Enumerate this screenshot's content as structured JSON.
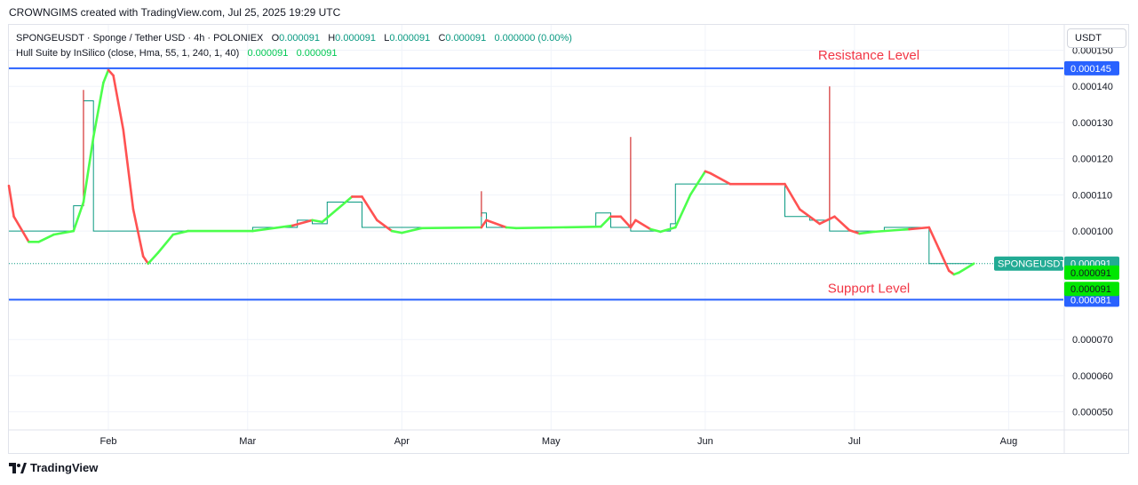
{
  "header": {
    "credit": "CROWNGIMS created with TradingView.com, Jul 25, 2025 19:29 UTC"
  },
  "legend": {
    "symbol_line": "SPONGEUSDT · Sponge / Tether USD · 4h · POLONIEX",
    "o_label": "O",
    "o_value": "0.000091",
    "h_label": "H",
    "h_value": "0.000091",
    "l_label": "L",
    "l_value": "0.000091",
    "c_label": "C",
    "c_value": "0.000091",
    "change": "0.000000 (0.00%)",
    "indicator_line": "Hull Suite by InSilico (close, Hma, 55, 1, 240, 1, 40)",
    "indicator_v1": "0.000091",
    "indicator_v2": "0.000091"
  },
  "currency_button": "USDT",
  "footer": {
    "brand": "TradingView"
  },
  "colors": {
    "price_line": "#089981",
    "hull_up": "#4cff4c",
    "hull_down": "#ff5252",
    "level_line": "#2962ff",
    "annotation": "#f23645",
    "symbol_tag": "#22ab94"
  },
  "chart_data": {
    "type": "line",
    "title": "",
    "ylim": [
      4.5e-05,
      0.000157
    ],
    "yaxis_ticks": [
      "0.000150",
      "0.000140",
      "0.000130",
      "0.000120",
      "0.000110",
      "0.000100",
      "0.000070",
      "0.000060",
      "0.000050"
    ],
    "xaxis_ticks": [
      "Feb",
      "Mar",
      "Apr",
      "May",
      "Jun",
      "Jul",
      "Aug"
    ],
    "grid": true,
    "horizontal_levels": [
      {
        "label": "Resistance Level",
        "value": 0.000145,
        "tag": "0.000145"
      },
      {
        "label": "Support Level",
        "value": 8.1e-05,
        "tag": "0.000081"
      }
    ],
    "price_tags": [
      {
        "text": "SPONGEUSDT",
        "value": 9.1e-05
      },
      {
        "text": "0.000091",
        "value": 9.1e-05
      },
      {
        "text": "0.000091",
        "value": 8.85e-05
      },
      {
        "text": "0.000091",
        "value": 8.4e-05
      }
    ],
    "price_series": [
      {
        "x": "2025-01-12",
        "y": 0.0001
      },
      {
        "x": "2025-01-25",
        "y": 0.0001
      },
      {
        "x": "2025-01-25",
        "y": 0.000107
      },
      {
        "x": "2025-01-27",
        "y": 0.000107
      },
      {
        "x": "2025-01-27",
        "y": 0.000136
      },
      {
        "x": "2025-01-29",
        "y": 0.000136
      },
      {
        "x": "2025-01-29",
        "y": 0.0001
      },
      {
        "x": "2025-03-02",
        "y": 0.0001
      },
      {
        "x": "2025-03-02",
        "y": 0.000101
      },
      {
        "x": "2025-03-11",
        "y": 0.000101
      },
      {
        "x": "2025-03-11",
        "y": 0.000103
      },
      {
        "x": "2025-03-14",
        "y": 0.000103
      },
      {
        "x": "2025-03-14",
        "y": 0.000102
      },
      {
        "x": "2025-03-17",
        "y": 0.000102
      },
      {
        "x": "2025-03-17",
        "y": 0.000108
      },
      {
        "x": "2025-03-24",
        "y": 0.000108
      },
      {
        "x": "2025-03-24",
        "y": 0.000101
      },
      {
        "x": "2025-04-17",
        "y": 0.000101
      },
      {
        "x": "2025-04-17",
        "y": 0.000105
      },
      {
        "x": "2025-04-18",
        "y": 0.000105
      },
      {
        "x": "2025-04-18",
        "y": 0.000101
      },
      {
        "x": "2025-05-10",
        "y": 0.000101
      },
      {
        "x": "2025-05-10",
        "y": 0.000105
      },
      {
        "x": "2025-05-13",
        "y": 0.000105
      },
      {
        "x": "2025-05-13",
        "y": 0.000101
      },
      {
        "x": "2025-05-17",
        "y": 0.000101
      },
      {
        "x": "2025-05-17",
        "y": 0.0001
      },
      {
        "x": "2025-05-25",
        "y": 0.0001
      },
      {
        "x": "2025-05-25",
        "y": 0.000102
      },
      {
        "x": "2025-05-26",
        "y": 0.000102
      },
      {
        "x": "2025-05-26",
        "y": 0.000113
      },
      {
        "x": "2025-06-17",
        "y": 0.000113
      },
      {
        "x": "2025-06-17",
        "y": 0.000104
      },
      {
        "x": "2025-06-22",
        "y": 0.000104
      },
      {
        "x": "2025-06-22",
        "y": 0.000103
      },
      {
        "x": "2025-06-26",
        "y": 0.000103
      },
      {
        "x": "2025-06-26",
        "y": 0.0001
      },
      {
        "x": "2025-07-07",
        "y": 0.0001
      },
      {
        "x": "2025-07-07",
        "y": 0.000101
      },
      {
        "x": "2025-07-16",
        "y": 0.000101
      },
      {
        "x": "2025-07-16",
        "y": 9.1e-05
      },
      {
        "x": "2025-07-25",
        "y": 9.1e-05
      }
    ],
    "price_spikes": [
      {
        "x": "2025-01-27",
        "low": 0.000107,
        "high": 0.000139
      },
      {
        "x": "2025-04-17",
        "low": 0.000104,
        "high": 0.000111
      },
      {
        "x": "2025-05-17",
        "low": 0.000101,
        "high": 0.000126
      },
      {
        "x": "2025-06-26",
        "low": 0.000103,
        "high": 0.00014
      }
    ],
    "hull_series": [
      {
        "x": "2025-01-12",
        "y": 0.0001125,
        "dir": "down"
      },
      {
        "x": "2025-01-13",
        "y": 0.000104,
        "dir": "down"
      },
      {
        "x": "2025-01-16",
        "y": 9.7e-05,
        "dir": "down"
      },
      {
        "x": "2025-01-18",
        "y": 9.7e-05,
        "dir": "up"
      },
      {
        "x": "2025-01-21",
        "y": 9.9e-05,
        "dir": "up"
      },
      {
        "x": "2025-01-25",
        "y": 0.0001,
        "dir": "up"
      },
      {
        "x": "2025-01-27",
        "y": 0.000108,
        "dir": "up"
      },
      {
        "x": "2025-01-29",
        "y": 0.000126,
        "dir": "up"
      },
      {
        "x": "2025-01-31",
        "y": 0.000141,
        "dir": "up"
      },
      {
        "x": "2025-02-01",
        "y": 0.0001445,
        "dir": "up"
      },
      {
        "x": "2025-02-02",
        "y": 0.000143,
        "dir": "down"
      },
      {
        "x": "2025-02-04",
        "y": 0.000128,
        "dir": "down"
      },
      {
        "x": "2025-02-06",
        "y": 0.000106,
        "dir": "down"
      },
      {
        "x": "2025-02-08",
        "y": 9.3e-05,
        "dir": "down"
      },
      {
        "x": "2025-02-09",
        "y": 9.1e-05,
        "dir": "down"
      },
      {
        "x": "2025-02-11",
        "y": 9.4e-05,
        "dir": "up"
      },
      {
        "x": "2025-02-14",
        "y": 9.9e-05,
        "dir": "up"
      },
      {
        "x": "2025-02-17",
        "y": 0.0001,
        "dir": "up"
      },
      {
        "x": "2025-03-02",
        "y": 0.0001,
        "dir": "up"
      },
      {
        "x": "2025-03-10",
        "y": 0.0001015,
        "dir": "up"
      },
      {
        "x": "2025-03-14",
        "y": 0.000103,
        "dir": "down"
      },
      {
        "x": "2025-03-16",
        "y": 0.0001025,
        "dir": "up"
      },
      {
        "x": "2025-03-19",
        "y": 0.000106,
        "dir": "up"
      },
      {
        "x": "2025-03-22",
        "y": 0.0001095,
        "dir": "up"
      },
      {
        "x": "2025-03-24",
        "y": 0.0001095,
        "dir": "down"
      },
      {
        "x": "2025-03-27",
        "y": 0.000103,
        "dir": "down"
      },
      {
        "x": "2025-03-30",
        "y": 0.0001,
        "dir": "down"
      },
      {
        "x": "2025-04-01",
        "y": 9.95e-05,
        "dir": "up"
      },
      {
        "x": "2025-04-05",
        "y": 0.0001008,
        "dir": "up"
      },
      {
        "x": "2025-04-17",
        "y": 0.000101,
        "dir": "up"
      },
      {
        "x": "2025-04-18",
        "y": 0.000103,
        "dir": "down"
      },
      {
        "x": "2025-04-22",
        "y": 0.000101,
        "dir": "down"
      },
      {
        "x": "2025-04-24",
        "y": 0.0001008,
        "dir": "up"
      },
      {
        "x": "2025-05-11",
        "y": 0.0001012,
        "dir": "up"
      },
      {
        "x": "2025-05-13",
        "y": 0.000104,
        "dir": "up"
      },
      {
        "x": "2025-05-15",
        "y": 0.000104,
        "dir": "down"
      },
      {
        "x": "2025-05-17",
        "y": 0.000101,
        "dir": "down"
      },
      {
        "x": "2025-05-18",
        "y": 0.000103,
        "dir": "down"
      },
      {
        "x": "2025-05-21",
        "y": 0.0001005,
        "dir": "down"
      },
      {
        "x": "2025-05-23",
        "y": 9.98e-05,
        "dir": "up"
      },
      {
        "x": "2025-05-26",
        "y": 0.000101,
        "dir": "up"
      },
      {
        "x": "2025-05-29",
        "y": 0.00011,
        "dir": "up"
      },
      {
        "x": "2025-06-01",
        "y": 0.0001165,
        "dir": "up"
      },
      {
        "x": "2025-06-02",
        "y": 0.000116,
        "dir": "down"
      },
      {
        "x": "2025-06-06",
        "y": 0.000113,
        "dir": "down"
      },
      {
        "x": "2025-06-17",
        "y": 0.000113,
        "dir": "down"
      },
      {
        "x": "2025-06-20",
        "y": 0.000106,
        "dir": "down"
      },
      {
        "x": "2025-06-24",
        "y": 0.000102,
        "dir": "down"
      },
      {
        "x": "2025-06-27",
        "y": 0.000104,
        "dir": "down"
      },
      {
        "x": "2025-06-30",
        "y": 0.0001002,
        "dir": "down"
      },
      {
        "x": "2025-07-02",
        "y": 9.93e-05,
        "dir": "down"
      },
      {
        "x": "2025-07-05",
        "y": 9.98e-05,
        "dir": "up"
      },
      {
        "x": "2025-07-12",
        "y": 0.0001005,
        "dir": "up"
      },
      {
        "x": "2025-07-16",
        "y": 0.000101,
        "dir": "down"
      },
      {
        "x": "2025-07-18",
        "y": 9.5e-05,
        "dir": "down"
      },
      {
        "x": "2025-07-20",
        "y": 8.9e-05,
        "dir": "down"
      },
      {
        "x": "2025-07-21",
        "y": 8.8e-05,
        "dir": "down"
      },
      {
        "x": "2025-07-22",
        "y": 8.85e-05,
        "dir": "up"
      },
      {
        "x": "2025-07-25",
        "y": 9.1e-05,
        "dir": "up"
      }
    ]
  }
}
